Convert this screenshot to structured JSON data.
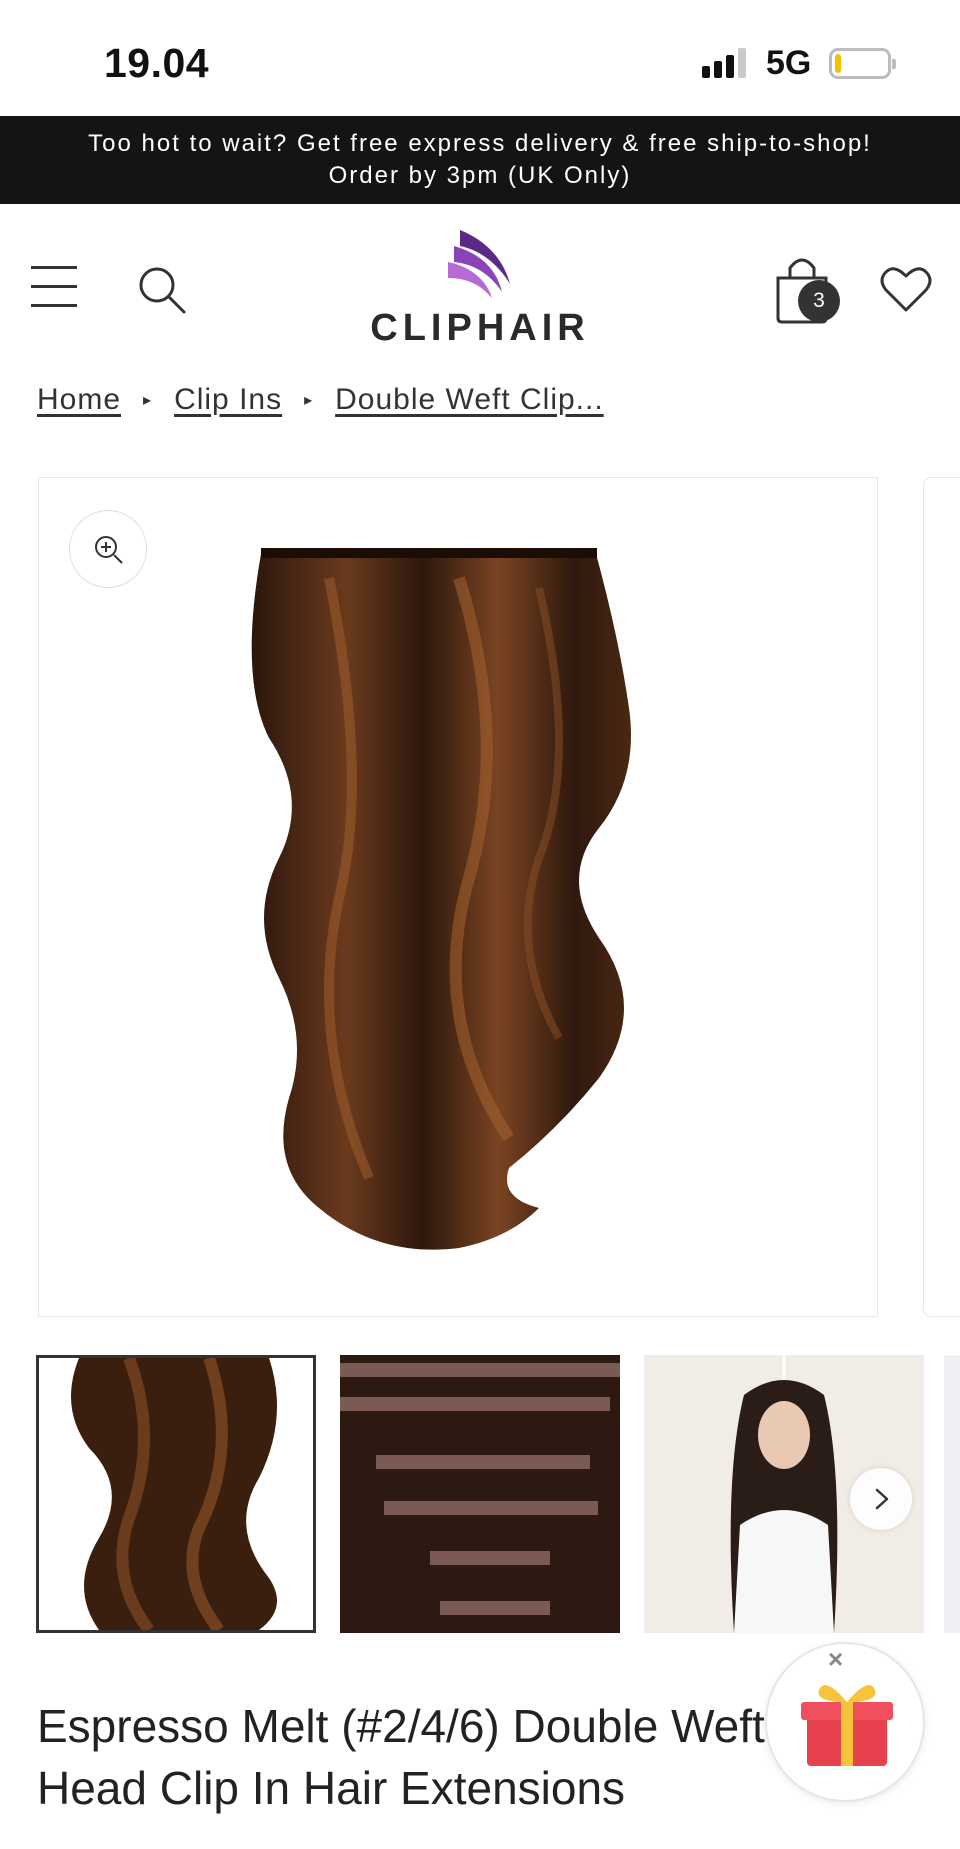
{
  "status_bar": {
    "time": "19.04",
    "network": "5G"
  },
  "announcement": {
    "line1": "Too hot to wait? Get free express delivery & free ship-to-shop!",
    "line2": "Order by 3pm (UK Only)"
  },
  "header": {
    "logo_text": "CLIPHAIR",
    "cart_count": "3",
    "brand_colors": {
      "logo_purple": "#7b3fa8",
      "logo_violet": "#a35bc7",
      "ink": "#2a2a2a"
    }
  },
  "breadcrumb": {
    "items": [
      "Home",
      "Clip Ins",
      "Double Weft Clip..."
    ]
  },
  "gallery": {
    "zoom_icon": "zoom-in-icon",
    "thumbnails": [
      "hair-wave-thumb",
      "clip-wefts-thumb",
      "model-before-after-thumb"
    ],
    "next_icon": "chevron-right-icon"
  },
  "product": {
    "title": "Espresso Melt (#2/4/6) Double Weft Full Head Clip In Hair Extensions"
  },
  "gift": {
    "close_label": "×"
  }
}
